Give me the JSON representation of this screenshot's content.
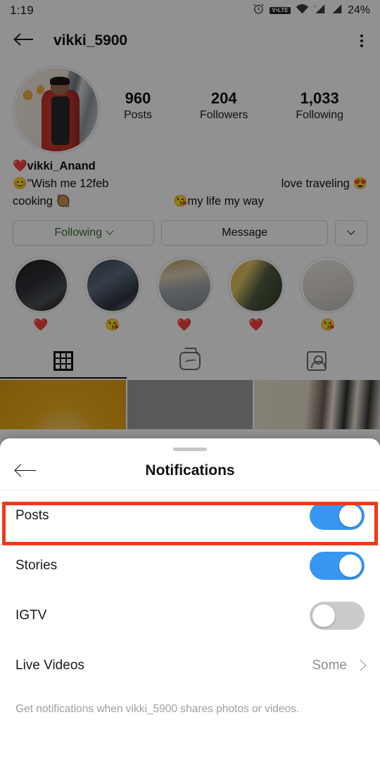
{
  "status_bar": {
    "time": "1:19",
    "battery": "24%",
    "icons": [
      "alarm-icon",
      "volte-icon",
      "wifi-icon",
      "signal-icon",
      "signal-icon"
    ],
    "volte_label": "V•LTE"
  },
  "nav": {
    "back_icon": "back-arrow-icon",
    "title": "vikki_5900",
    "more_icon": "more-options-icon"
  },
  "profile": {
    "avatar_alt": "profile-photo",
    "stats": [
      {
        "value": "960",
        "label": "Posts"
      },
      {
        "value": "204",
        "label": "Followers"
      },
      {
        "value": "1,033",
        "label": "Following"
      }
    ],
    "bio": {
      "name": "❤️vikki_Anand",
      "line2_left": "😊\"Wish me 12feb",
      "line2_right": "love traveling 😍",
      "line3_left": "cooking 🥘",
      "line3_mid": "😘my life my way"
    },
    "buttons": {
      "following": "Following",
      "message": "Message",
      "more_icon": "chevron-down-icon"
    },
    "following_color": "#3a6b33",
    "highlights": [
      {
        "label": "❤️"
      },
      {
        "label": "😘"
      },
      {
        "label": "❤️"
      },
      {
        "label": "❤️"
      },
      {
        "label": "😘"
      }
    ],
    "tabs": [
      {
        "name": "grid-tab",
        "icon": "grid-icon",
        "active": true
      },
      {
        "name": "igtv-tab",
        "icon": "igtv-icon",
        "active": false
      },
      {
        "name": "tagged-tab",
        "icon": "tagged-icon",
        "active": false
      }
    ]
  },
  "sheet": {
    "handle": "drag-handle",
    "back_icon": "back-arrow-icon",
    "title": "Notifications",
    "rows": [
      {
        "label": "Posts",
        "type": "toggle",
        "state": "on",
        "highlighted": true
      },
      {
        "label": "Stories",
        "type": "toggle",
        "state": "on",
        "highlighted": false
      },
      {
        "label": "IGTV",
        "type": "toggle",
        "state": "off",
        "highlighted": false
      },
      {
        "label": "Live Videos",
        "type": "value",
        "value": "Some",
        "highlighted": false
      }
    ],
    "footer": "Get notifications when vikki_5900 shares photos or videos."
  },
  "colors": {
    "toggle_on": "#3897f0",
    "toggle_off": "#c9cbcd",
    "annotation": "#ee3a1a",
    "following_green": "#3a6b33"
  }
}
